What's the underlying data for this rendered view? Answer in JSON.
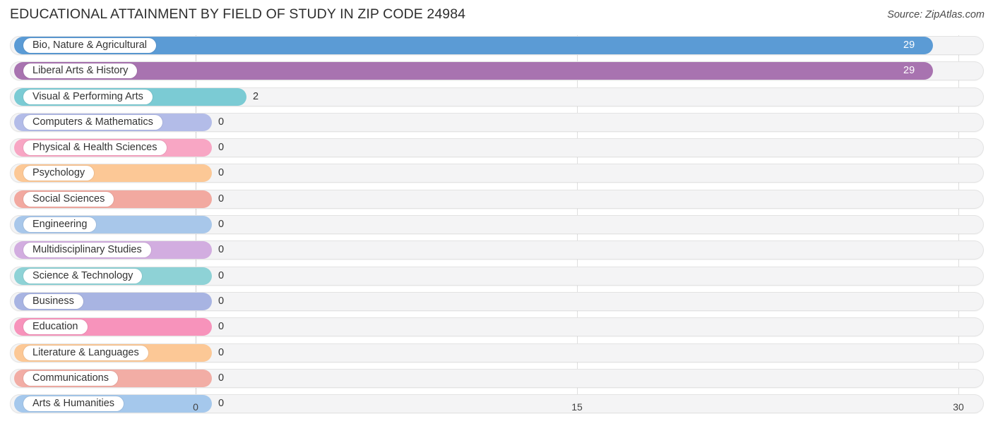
{
  "header": {
    "title": "EDUCATIONAL ATTAINMENT BY FIELD OF STUDY IN ZIP CODE 24984",
    "source": "Source: ZipAtlas.com"
  },
  "chart_data": {
    "type": "bar",
    "orientation": "horizontal",
    "title": "EDUCATIONAL ATTAINMENT BY FIELD OF STUDY IN ZIP CODE 24984",
    "xlabel": "",
    "ylabel": "",
    "xlim": [
      0,
      30
    ],
    "xticks": [
      0,
      15,
      30
    ],
    "xtick_labels": [
      "0",
      "15",
      "30"
    ],
    "grid": true,
    "legend": false,
    "categories": [
      "Bio, Nature & Agricultural",
      "Liberal Arts & History",
      "Visual & Performing Arts",
      "Computers & Mathematics",
      "Physical & Health Sciences",
      "Psychology",
      "Social Sciences",
      "Engineering",
      "Multidisciplinary Studies",
      "Science & Technology",
      "Business",
      "Education",
      "Literature & Languages",
      "Communications",
      "Arts & Humanities"
    ],
    "values": [
      29,
      29,
      2,
      0,
      0,
      0,
      0,
      0,
      0,
      0,
      0,
      0,
      0,
      0,
      0
    ],
    "value_labels": [
      "29",
      "29",
      "2",
      "0",
      "0",
      "0",
      "0",
      "0",
      "0",
      "0",
      "0",
      "0",
      "0",
      "0",
      "0"
    ],
    "colors": [
      "#5b9bd5",
      "#a873b0",
      "#7bcbd4",
      "#b3bce8",
      "#f8a6c4",
      "#fcc896",
      "#f2a9a0",
      "#a8c7ea",
      "#d2ade0",
      "#8ed2d6",
      "#a8b4e2",
      "#f793bb",
      "#fcc896",
      "#f2ada5",
      "#a5c8ec"
    ]
  }
}
